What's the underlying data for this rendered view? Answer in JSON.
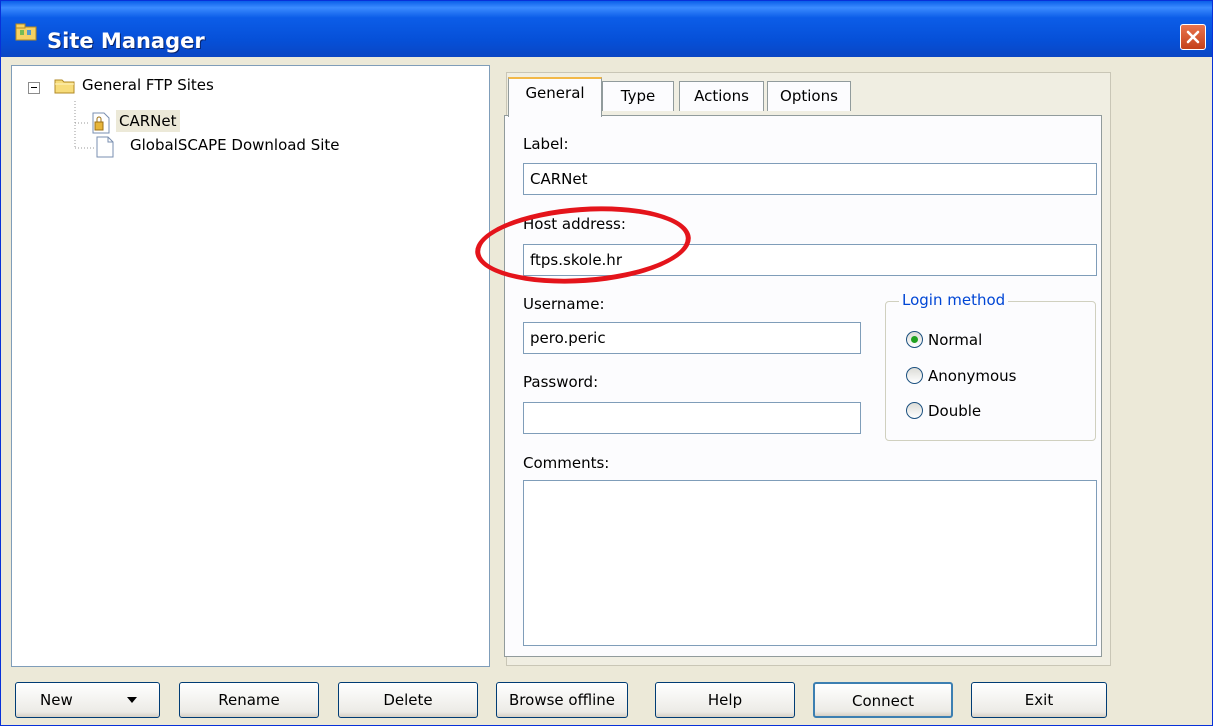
{
  "window": {
    "title": "Site Manager"
  },
  "tree": {
    "root": "General FTP Sites",
    "items": [
      "CARNet",
      "GlobalSCAPE Download Site"
    ]
  },
  "tabs": [
    "General",
    "Type",
    "Actions",
    "Options"
  ],
  "form": {
    "label_caption": "Label:",
    "label_value": "CARNet",
    "host_caption": "Host address:",
    "host_value": "ftps.skole.hr",
    "username_caption": "Username:",
    "username_value": "pero.peric",
    "password_caption": "Password:",
    "password_value": "",
    "comments_caption": "Comments:",
    "comments_value": ""
  },
  "login_method": {
    "title": "Login method",
    "options": [
      "Normal",
      "Anonymous",
      "Double"
    ],
    "selected": "Normal"
  },
  "buttons": {
    "new": "New",
    "rename": "Rename",
    "delete": "Delete",
    "browse_offline": "Browse offline",
    "help": "Help",
    "connect": "Connect",
    "exit": "Exit"
  },
  "colors": {
    "titlebar": "#0a5fe9",
    "highlight_circle": "#e4141b",
    "group_title": "#0046d5"
  }
}
